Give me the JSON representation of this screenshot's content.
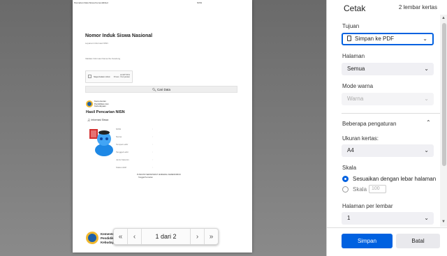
{
  "preview": {
    "header_left": "Pencarian Data Siswa Kemendikbud",
    "header_right": "NISN",
    "doc_title": "Nomor Induk Siswa Nasional",
    "subtitle_1": "Layanan Informasi NISN",
    "subtitle_2": "Validasi Informasi Nama Ibu Kandung",
    "captcha_label": "Saya bukan robot",
    "captcha_brand": "reCAPTCHA",
    "captcha_terms": "Privasi · Persyaratan",
    "search_button": "Cari Data",
    "ministry_name_small": "Kementerian Pendidikan dan Kebudayaan",
    "result_title": "Hasil Pencarian NISN",
    "info_label": "Informasi Siswa",
    "fields": [
      {
        "label": "NISN",
        "value": ":"
      },
      {
        "label": "Nama",
        "value": ":"
      },
      {
        "label": "Tempat Lahir",
        "value": ":"
      },
      {
        "label": "Tanggal Lahir",
        "value": ":"
      },
      {
        "label": "Jenis Kelamin",
        "value": ":"
      },
      {
        "label": "Status Aktif",
        "value": ":"
      }
    ],
    "footnote_1": "PUSDATIN SEKRETARIAT JENDERAL KEMENDIKBUD",
    "footnote_2": "Tanggal Pencarian",
    "ministry_name_large": "Kementerian Pendidikan dan Kebudayaan",
    "ministry_short": [
      "Kementer",
      "Pendidik",
      "Kebuday"
    ]
  },
  "pager": {
    "first": "«",
    "prev": "‹",
    "counter": "1 dari 2",
    "next": "›",
    "last": "»"
  },
  "panel": {
    "title": "Cetak",
    "sheet_count": "2 lembar kertas",
    "destination_label": "Tujuan",
    "destination_value": "Simpan ke PDF",
    "pages_label": "Halaman",
    "pages_value": "Semua",
    "color_mode_label": "Mode warna",
    "color_mode_value": "Warna",
    "more_settings_label": "Beberapa pengaturan",
    "paper_size_label": "Ukuran kertas:",
    "paper_size_value": "A4",
    "scale_label": "Skala",
    "scale_fit_label": "Sesuaikan dengan lebar halaman",
    "scale_custom_label": "Skala",
    "scale_value": "100",
    "pages_per_sheet_label": "Halaman per lembar",
    "pages_per_sheet_value": "1",
    "save_button": "Simpan",
    "cancel_button": "Batal"
  },
  "colors": {
    "accent": "#0061e0",
    "ministry_blue": "#1d5fa8",
    "ministry_gold": "#f1b82d"
  }
}
